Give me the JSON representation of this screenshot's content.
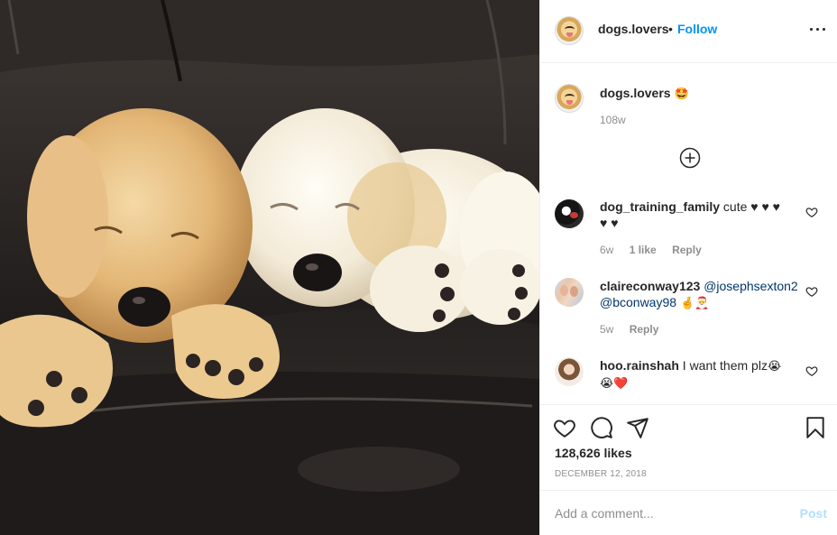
{
  "post": {
    "author": "dogs.lovers",
    "dot": "•",
    "follow_label": "Follow",
    "caption_emoji": "🤩",
    "caption_time": "108w",
    "likes": "128,626 likes",
    "date": "DECEMBER 12, 2018"
  },
  "comments": [
    {
      "user": "dog_training_family",
      "text": " cute ♥ ♥ ♥",
      "text2": "♥ ♥",
      "time": "6w",
      "likes": "1 like",
      "reply": "Reply"
    },
    {
      "user": "claireconway123",
      "mention1": "@josephsexton2",
      "mention2": "@bconway98",
      "emoji": "🤞🎅",
      "time": "5w",
      "reply": "Reply"
    },
    {
      "user": "hoo.rainshah",
      "text": " I want them plz",
      "emoji1": "😭",
      "emoji2": "😭❤️"
    }
  ],
  "composer": {
    "placeholder": "Add a comment...",
    "post_label": "Post"
  },
  "icons": [
    "more-icon",
    "add-comments-icon",
    "heart-icon",
    "comment-icon",
    "share-icon",
    "bookmark-icon"
  ]
}
